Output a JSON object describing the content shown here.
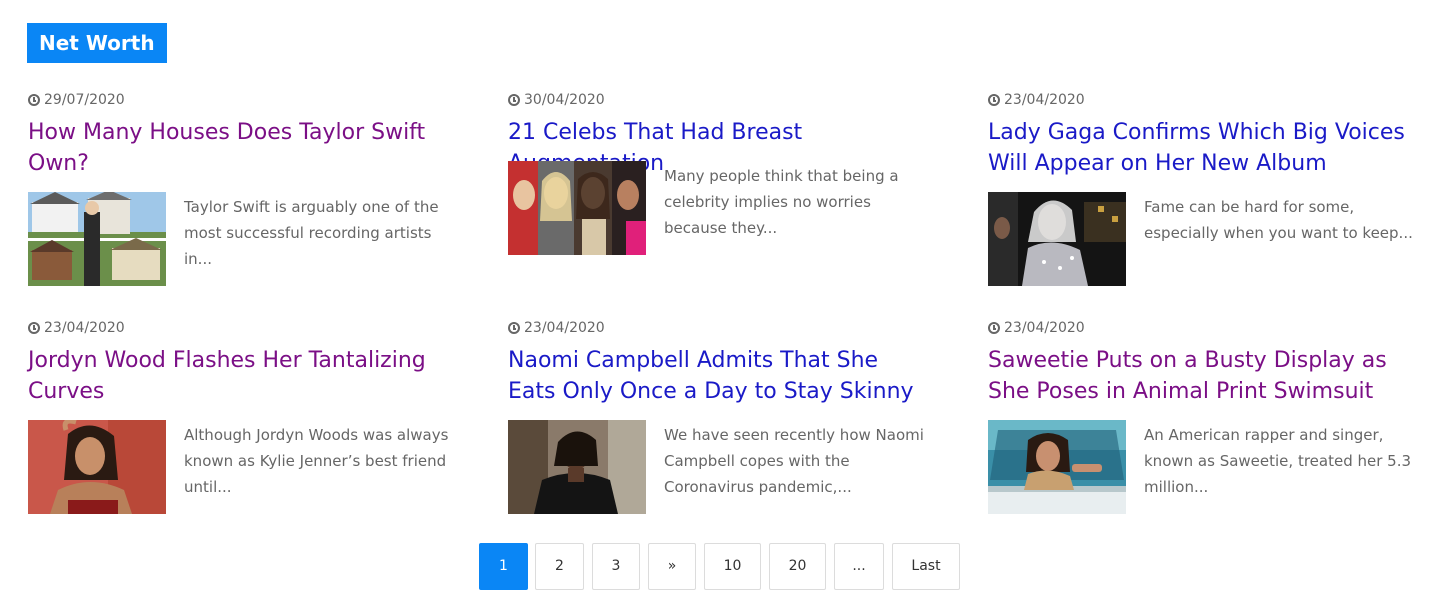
{
  "section": {
    "title": "Net Worth"
  },
  "articles": [
    {
      "date": "29/07/2020",
      "title": "How Many Houses Does Taylor Swift Own?",
      "excerpt": "Taylor Swift is arguably one of the most successful recording artists in...",
      "image": "taylor-swift-houses-photo"
    },
    {
      "date": "30/04/2020",
      "title": "21 Celebs That Had Breast Augmentation",
      "excerpt": "Many people think that being a celebrity implies no worries because they...",
      "image": "celebrities-collage-photo"
    },
    {
      "date": "23/04/2020",
      "title": "Lady Gaga Confirms Which Big Voices Will Appear on Her New Album",
      "excerpt": "Fame can be hard for some, especially when you want to keep...",
      "image": "lady-gaga-photo"
    },
    {
      "date": "23/04/2020",
      "title": "Jordyn Wood Flashes Her Tantalizing Curves",
      "excerpt": "Although Jordyn Woods was always known as Kylie Jenner’s best friend until...",
      "image": "jordyn-woods-photo"
    },
    {
      "date": "23/04/2020",
      "title": "Naomi Campbell Admits That She Eats Only Once a Day to Stay Skinny",
      "excerpt": "We have seen recently how Naomi Campbell copes with the Coronavirus pandemic,...",
      "image": "naomi-campbell-photo"
    },
    {
      "date": "23/04/2020",
      "title": "Saweetie Puts on a Busty Display as She Poses in Animal Print Swimsuit",
      "excerpt": "An American rapper and singer, known as Saweetie, treated her 5.3 million...",
      "image": "saweetie-car-photo"
    }
  ],
  "pagination": {
    "current": "1",
    "items": [
      "1",
      "2",
      "3",
      "»",
      "10",
      "20",
      "...",
      "Last"
    ]
  },
  "colors": {
    "accent": "#0a86f5",
    "visited_link": "#7b0f86",
    "link": "#1a1ac7",
    "muted_text": "#666666"
  }
}
